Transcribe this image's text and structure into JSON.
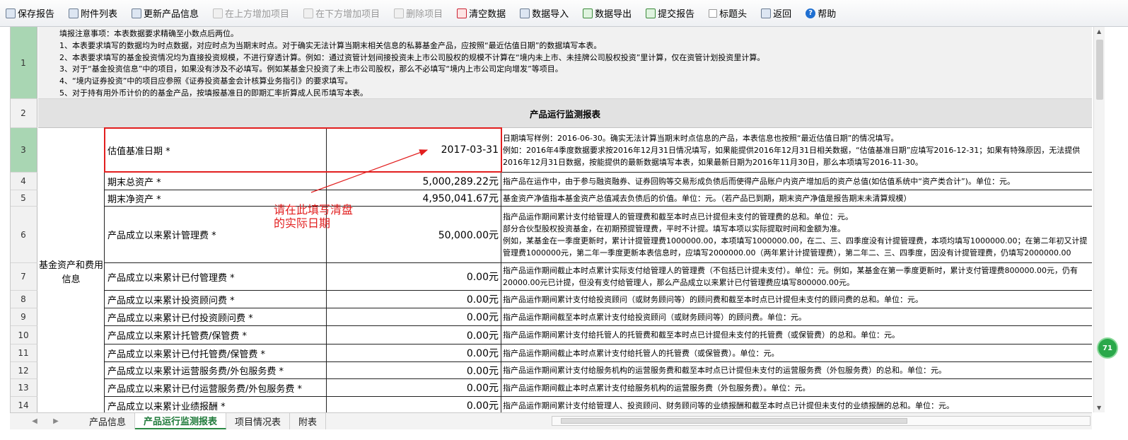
{
  "toolbar": {
    "items": [
      {
        "label": "保存报告",
        "icon": "save-icon",
        "enabled": true
      },
      {
        "label": "附件列表",
        "icon": "attachment-icon",
        "enabled": true
      },
      {
        "label": "更新产品信息",
        "icon": "update-icon",
        "enabled": true
      },
      {
        "label": "在上方增加项目",
        "icon": "insert-above-icon",
        "enabled": false
      },
      {
        "label": "在下方增加项目",
        "icon": "insert-below-icon",
        "enabled": false
      },
      {
        "label": "删除项目",
        "icon": "delete-icon",
        "enabled": false
      },
      {
        "label": "清空数据",
        "icon": "clear-icon",
        "enabled": true
      },
      {
        "label": "数据导入",
        "icon": "import-icon",
        "enabled": true
      },
      {
        "label": "数据导出",
        "icon": "export-icon",
        "enabled": true
      },
      {
        "label": "提交报告",
        "icon": "submit-icon",
        "enabled": true
      },
      {
        "label": "标题头",
        "icon": "checkbox-icon",
        "enabled": true
      },
      {
        "label": "返回",
        "icon": "back-icon",
        "enabled": true
      },
      {
        "label": "帮助",
        "icon": "help-icon",
        "enabled": true
      }
    ]
  },
  "sheet": {
    "row_numbers": [
      "1",
      "2",
      "3",
      "4",
      "5",
      "6",
      "7",
      "8",
      "9",
      "10",
      "11",
      "12",
      "13",
      "14"
    ],
    "notes": [
      "填报注意事项：本表数据要求精确至小数点后两位。",
      "1、本表要求填写的数据均为时点数据，对应时点为当期末时点。对于确实无法计算当期末相关信息的私募基金产品，应按照“最近估值日期”的数据填写本表。",
      "2、本表要求填写的基金投资情况均为直接投资规模，不进行穿透计算。例如：通过资管计划间接投资未上市公司股权的规模不计算在“境内未上市、未挂牌公司股权投资”里计算，仅在资管计划投资里计算。",
      "3、对于“基金投资信息”中的项目，如果没有涉及不必填写。例如某基金只投资了未上市公司股权，那么不必填写“境内上市公司定向增发”等项目。",
      "4、“境内证券投资”中的项目应参照《证券投资基金会计核算业务指引》的要求填写。",
      "5、对于持有用外币计价的的基金产品，按填报基准日的即期汇率折算成人民币填写本表。"
    ],
    "title": "产品运行监测报表",
    "group_label": "基金资产和费用信息",
    "rows": [
      {
        "label": "估值基准日期 *",
        "value": "2017-03-31",
        "desc": [
          "日期填写样例：2016-06-30。确实无法计算当期末时点信息的产品，本表信息也按照“最近估值日期”的情况填写。",
          "例如：2016年4季度数据要求按2016年12月31日情况填写，如果能提供2016年12月31日相关数据，“估值基准日期”应填写2016-12-31；如果有特殊原因，无法提供2016年12月31日数据，按能提供的最新数据填写本表，如果最新日期为2016年11月30日，那么本项填写2016-11-30。"
        ]
      },
      {
        "label": "期末总资产 *",
        "value": "5,000,289.22元",
        "desc": [
          "指产品在运作中，由于参与融资融券、证券回购等交易形成负债后而使得产品账户内资产增加后的资产总值(如估值系统中“资产类合计”)。单位：元。"
        ]
      },
      {
        "label": "期末净资产 *",
        "value": "4,950,041.67元",
        "desc": [
          "基金资产净值指本基金资产总值减去负债后的价值。单位：元。（若产品已到期，期末资产净值是报告期末未清算规模）"
        ]
      },
      {
        "label": "产品成立以来累计管理费 *",
        "value": "50,000.00元",
        "desc": [
          "指产品运作期间累计支付给管理人的管理费和截至本时点已计提但未支付的管理费的总和。单位：元。",
          "部分合伙型股权投资基金，在初期预提管理费，平时不计提。填写本项以实际提取时间和金额为准。",
          "例如，某基金在一季度更新时，累计计提管理费1000000.00，本项填写1000000.00，在二、三、四季度没有计提管理费，本项均填写1000000.00；在第二年初又计提管理费1000000元，第二年一季度更新本表信息时，应填写2000000.00（两年累计计提管理费），第二年二、三、四季度，因没有计提管理费，仍填写2000000.00"
        ]
      },
      {
        "label": "产品成立以来累计已付管理费 *",
        "value": "0.00元",
        "desc": [
          "指产品运作期间截止本时点累计实际支付给管理人的管理费（不包括已计提未支付）。单位：元。例如，某基金在第一季度更新时，累计支付管理费800000.00元，仍有20000.00元已计提，但没有支付给管理人，那么产品成立以来累计已付管理费应填写800000.00元。"
        ]
      },
      {
        "label": "产品成立以来累计投资顾问费 *",
        "value": "0.00元",
        "desc": [
          "指产品运作期间累计支付给投资顾问（或财务顾问等）的顾问费和截至本时点已计提但未支付的顾问费的总和。单位：元。"
        ]
      },
      {
        "label": "产品成立以来累计已付投资顾问费 *",
        "value": "0.00元",
        "desc": [
          "指产品运作期间截至本时点累计支付给投资顾问（或财务顾问等）的顾问费。单位：元。"
        ]
      },
      {
        "label": "产品成立以来累计托管费/保管费 *",
        "value": "0.00元",
        "desc": [
          "指产品运作期间累计支付给托管人的托管费和截至本时点已计提但未支付的托管费（或保管费）的总和。单位：元。"
        ]
      },
      {
        "label": "产品成立以来累计已付托管费/保管费 *",
        "value": "0.00元",
        "desc": [
          "指产品运作期间截止本时点累计支付给托管人的托管费（或保管费）。单位：元。"
        ]
      },
      {
        "label": "产品成立以来累计运营服务费/外包服务费 *",
        "value": "0.00元",
        "desc": [
          "指产品运作期间累计支付给服务机构的运营服务费和截至本时点已计提但未支付的运营服务费（外包服务费）的总和。单位：元。"
        ]
      },
      {
        "label": "产品成立以来累计已付运营服务费/外包服务费 *",
        "value": "0.00元",
        "desc": [
          "指产品运作期间截止本时点累计支付给服务机构的运营服务费（外包服务费）。单位：元。"
        ]
      },
      {
        "label": "产品成立以来累计业绩报酬 *",
        "value": "0.00元",
        "desc": [
          "指产品运作期间累计支付给管理人、投资顾问、财务顾问等的业绩报酬和截至本时点已计提但未支付的业绩报酬的总和。单位：元。"
        ]
      }
    ],
    "annotation": [
      "请在此填写清盘",
      "的实际日期"
    ]
  },
  "bubble_text": "71",
  "tabs": [
    {
      "label": "产品信息",
      "active": false
    },
    {
      "label": "产品运行监测报表",
      "active": true
    },
    {
      "label": "项目情况表",
      "active": false
    },
    {
      "label": "附表",
      "active": false
    }
  ],
  "colors": {
    "annotation": "#e21f1f",
    "active_tab": "#1f7a3a",
    "selected_row": "#a9d6b3"
  }
}
